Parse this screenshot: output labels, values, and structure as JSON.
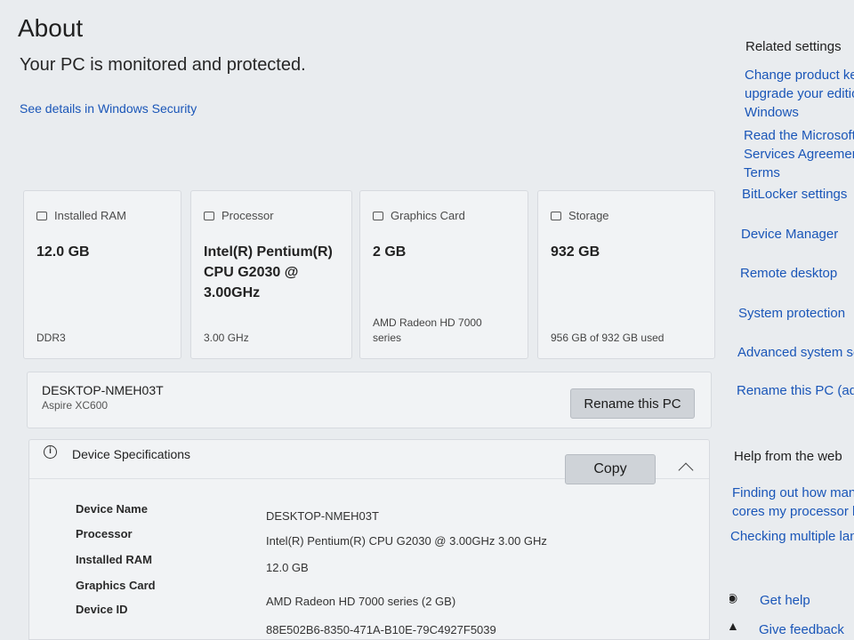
{
  "header": {
    "title": "About",
    "protection_status": "Your PC is monitored and protected.",
    "security_link": "See details in Windows Security"
  },
  "cards": [
    {
      "label": "Installed RAM",
      "icon": "memory-icon",
      "value": "12.0 GB",
      "footer": "DDR3"
    },
    {
      "label": "Processor",
      "icon": "processor-icon",
      "value": "Intel(R) Pentium(R) CPU G2030 @ 3.00GHz",
      "footer": "3.00 GHz"
    },
    {
      "label": "Graphics Card",
      "icon": "graphics-card-icon",
      "value": "2 GB",
      "footer": "AMD Radeon HD 7000 series"
    },
    {
      "label": "Storage",
      "icon": "storage-icon",
      "value": "932 GB",
      "footer": "956 GB of 932 GB used"
    }
  ],
  "pc": {
    "name": "DESKTOP-NMEH03T",
    "model": "Aspire XC600",
    "rename_label": "Rename this PC"
  },
  "specs": {
    "title": "Device Specifications",
    "copy_label": "Copy",
    "rows": [
      {
        "label": "Device Name",
        "value": "DESKTOP-NMEH03T"
      },
      {
        "label": "Processor",
        "value": "Intel(R) Pentium(R) CPU G2030 @ 3.00GHz   3.00 GHz"
      },
      {
        "label": "Installed RAM",
        "value": "12.0 GB"
      },
      {
        "label": "Graphics Card",
        "value": "AMD Radeon HD 7000 series (2 GB)"
      },
      {
        "label": "Device ID",
        "value": "88E502B6-8350-471A-B10E-79C4927F5039"
      }
    ]
  },
  "related": {
    "heading": "Related settings",
    "links": [
      "Change product key or upgrade your edition of Windows",
      "Read the Microsoft Services Agreement Terms",
      "BitLocker settings",
      "Device Manager",
      "Remote desktop",
      "System protection",
      "Advanced system settings",
      "Rename this PC (advanced)"
    ]
  },
  "help": {
    "heading": "Help from the web",
    "links": [
      "Finding out how many cores my processor has",
      "Checking multiple languages"
    ],
    "get_help": "Get help",
    "give_feedback": "Give feedback"
  }
}
